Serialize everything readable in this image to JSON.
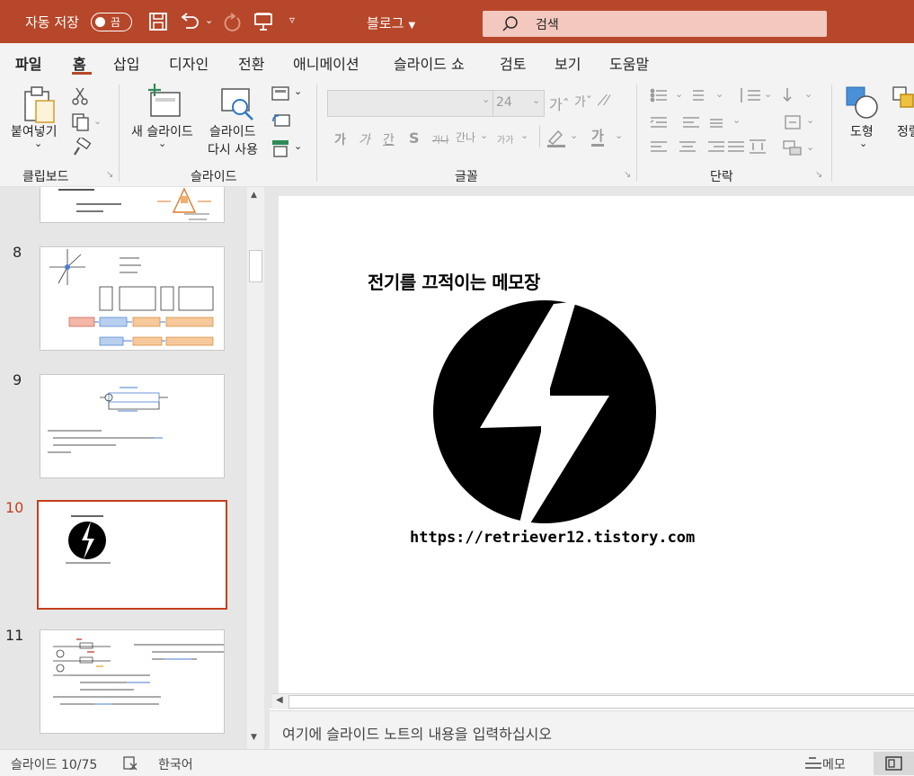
{
  "titlebar": {
    "autosave_label": "자동 저장",
    "autosave_state": "끔",
    "doc_title": "블로그",
    "search_placeholder": "검색"
  },
  "tabs": [
    "파일",
    "홈",
    "삽입",
    "디자인",
    "전환",
    "애니메이션",
    "슬라이드 쇼",
    "검토",
    "보기",
    "도움말"
  ],
  "active_tab": "홈",
  "ribbon": {
    "clipboard": {
      "paste_label": "붙여넣기",
      "group_label": "클립보드"
    },
    "slides": {
      "new_slide_label": "새 슬라이드",
      "reuse_line1": "슬라이드",
      "reuse_line2": "다시 사용",
      "group_label": "슬라이드"
    },
    "font": {
      "font_size": "24",
      "grow_label": "가ˆ",
      "shrink_label": "가ˇ",
      "bold_label": "가",
      "italic_label": "가",
      "underline_label": "간",
      "shadow_label": "S",
      "strike_label": "가나",
      "spacing_label": "간나",
      "case_label": "가가",
      "color_label": "가",
      "group_label": "글꼴"
    },
    "paragraph": {
      "group_label": "단락"
    },
    "drawing": {
      "shapes_label": "도형",
      "arrange_label": "정렬"
    }
  },
  "thumbnails": [
    {
      "number": "8"
    },
    {
      "number": "9"
    },
    {
      "number": "10"
    },
    {
      "number": "11"
    }
  ],
  "active_slide": "10",
  "slide": {
    "title": "전기를 끄적이는 메모장",
    "url": "https://retriever12.tistory.com"
  },
  "notes_placeholder": "여기에 슬라이드 노트의 내용을 입력하십시오",
  "status": {
    "slide_counter": "슬라이드 10/75",
    "language": "한국어",
    "notes_button": "메모"
  },
  "colors": {
    "accent": "#b7472a",
    "active_thumb": "#c43e1c"
  }
}
